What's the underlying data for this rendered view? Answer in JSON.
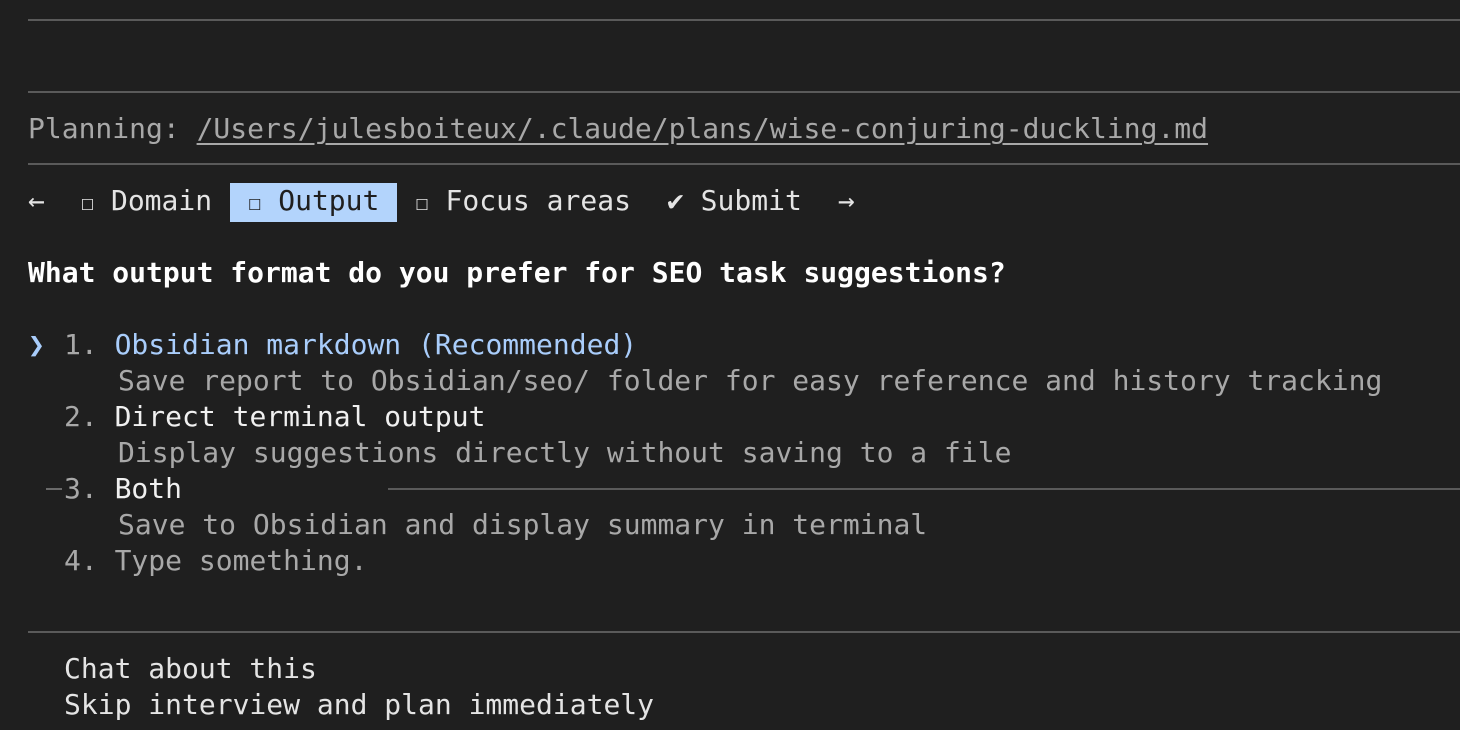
{
  "planning": {
    "prefix": "Planning: ",
    "path": "/Users/julesboiteux/.claude/plans/wise-conjuring-duckling.md"
  },
  "tabs": {
    "prev_arrow": "←",
    "next_arrow": "→",
    "items": [
      {
        "box": "☐",
        "label": "Domain",
        "active": false
      },
      {
        "box": "☐",
        "label": "Output",
        "active": true
      },
      {
        "box": "☐",
        "label": "Focus areas",
        "active": false
      },
      {
        "box": "✔",
        "label": "Submit",
        "active": false
      }
    ],
    "active_color": "#b3d4fc"
  },
  "question": "What output format do you prefer for SEO task suggestions?",
  "options": [
    {
      "cursor": "❯",
      "number": "1.",
      "label": "Obsidian markdown (Recommended)",
      "description": "Save report to Obsidian/seo/ folder for easy reference and history tracking",
      "selected": true
    },
    {
      "cursor": "",
      "number": "2.",
      "label": "Direct terminal output",
      "description": "Display suggestions directly without saving to a file",
      "selected": false
    },
    {
      "cursor": "",
      "number": "3.",
      "label": "Both",
      "description": "Save to Obsidian and display summary in terminal",
      "selected": false
    },
    {
      "cursor": "",
      "number": "4.",
      "label": "Type something.",
      "description": "",
      "selected": false
    }
  ],
  "footer": {
    "chat": "Chat about this",
    "skip": "Skip interview and plan immediately"
  },
  "colors": {
    "background": "#1f1f1f",
    "accent": "#a9cdfb",
    "muted": "#a8a8a8"
  }
}
